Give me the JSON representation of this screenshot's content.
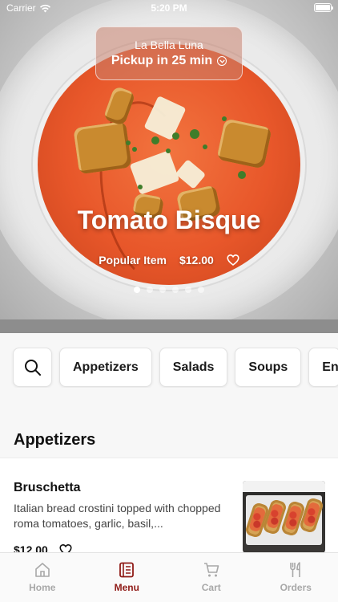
{
  "status_bar": {
    "carrier": "Carrier",
    "time": "5:20 PM"
  },
  "pickup": {
    "restaurant": "La Bella Luna",
    "label": "Pickup in 25 min"
  },
  "featured": {
    "title": "Tomato Bisque",
    "badge": "Popular Item",
    "price": "$12.00",
    "total_slides": 6,
    "active_slide": 1
  },
  "categories": [
    "Appetizers",
    "Salads",
    "Soups",
    "En"
  ],
  "section": {
    "title": "Appetizers"
  },
  "items": [
    {
      "name": "Bruschetta",
      "description": "Italian bread crostini topped with chopped roma tomatoes, garlic, basil,...",
      "price": "$12.00"
    }
  ],
  "tabs": [
    {
      "label": "Home",
      "icon": "home-icon",
      "active": false
    },
    {
      "label": "Menu",
      "icon": "menu-icon",
      "active": true
    },
    {
      "label": "Cart",
      "icon": "cart-icon",
      "active": false
    },
    {
      "label": "Orders",
      "icon": "orders-icon",
      "active": false
    }
  ],
  "colors": {
    "accent": "#8f1a16",
    "inactive_tab": "#a8a8a8",
    "soup": "#e8572a"
  }
}
